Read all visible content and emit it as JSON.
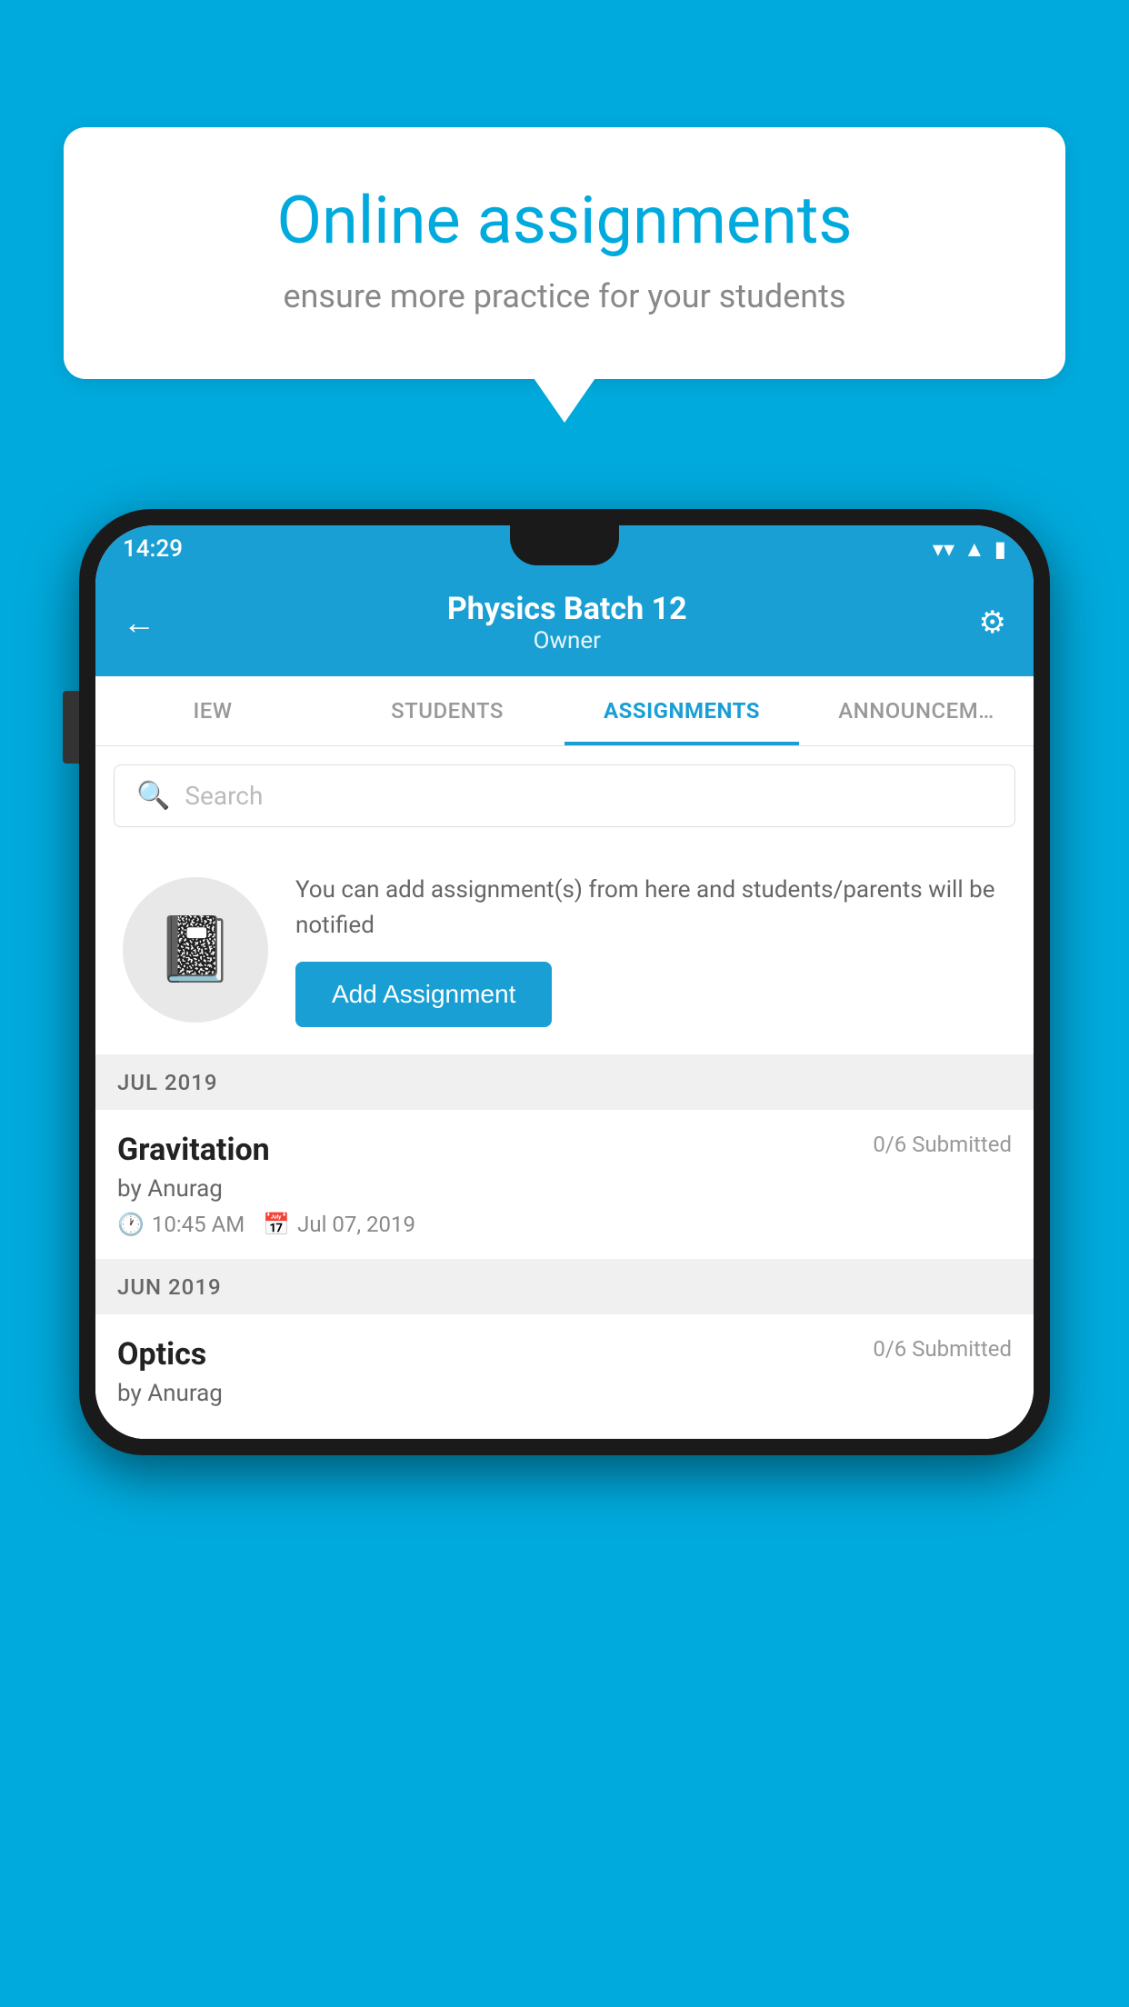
{
  "background": {
    "color": "#00AADD"
  },
  "speech_bubble": {
    "title": "Online assignments",
    "subtitle": "ensure more practice for your students"
  },
  "status_bar": {
    "time": "14:29",
    "wifi_icon": "▼",
    "signal_icon": "▲",
    "battery_icon": "▮"
  },
  "header": {
    "title": "Physics Batch 12",
    "subtitle": "Owner",
    "back_label": "←",
    "settings_label": "⚙"
  },
  "tabs": [
    {
      "label": "IEW",
      "active": false
    },
    {
      "label": "STUDENTS",
      "active": false
    },
    {
      "label": "ASSIGNMENTS",
      "active": true
    },
    {
      "label": "ANNOUNCEMENTS",
      "active": false
    }
  ],
  "search": {
    "placeholder": "Search"
  },
  "promo": {
    "text": "You can add assignment(s) from here and students/parents will be notified",
    "button_label": "Add Assignment"
  },
  "sections": [
    {
      "label": "JUL 2019",
      "assignments": [
        {
          "name": "Gravitation",
          "submitted": "0/6 Submitted",
          "by": "by Anurag",
          "time": "10:45 AM",
          "date": "Jul 07, 2019"
        }
      ]
    },
    {
      "label": "JUN 2019",
      "assignments": [
        {
          "name": "Optics",
          "submitted": "0/6 Submitted",
          "by": "by Anurag",
          "time": "",
          "date": ""
        }
      ]
    }
  ]
}
